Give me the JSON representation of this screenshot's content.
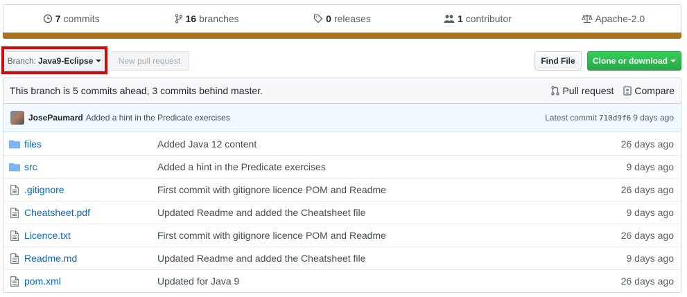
{
  "summary": {
    "commits": {
      "count": "7",
      "label": "commits"
    },
    "branches": {
      "count": "16",
      "label": "branches"
    },
    "releases": {
      "count": "0",
      "label": "releases"
    },
    "contributors": {
      "count": "1",
      "label": "contributor"
    },
    "license": "Apache-2.0"
  },
  "language_bar_color": "#b07219",
  "toolbar": {
    "branch_label": "Branch:",
    "branch_value": "Java9-Eclipse",
    "new_pr": "New pull request",
    "find_file": "Find File",
    "clone": "Clone or download"
  },
  "branch_info": {
    "text": "This branch is 5 commits ahead, 3 commits behind master.",
    "pull_request": "Pull request",
    "compare": "Compare"
  },
  "commit": {
    "author": "JosePaumard",
    "message": "Added a hint in the Predicate exercises",
    "latest_label": "Latest commit",
    "sha": "710d9f6",
    "age": "9 days ago"
  },
  "files": [
    {
      "type": "folder",
      "name": "files",
      "message": "Added Java 12 content",
      "age": "26 days ago"
    },
    {
      "type": "folder",
      "name": "src",
      "message": "Added a hint in the Predicate exercises",
      "age": "9 days ago"
    },
    {
      "type": "file",
      "name": ".gitignore",
      "message": "First commit with gitignore licence POM and Readme",
      "age": "26 days ago"
    },
    {
      "type": "file",
      "name": "Cheatsheet.pdf",
      "message": "Updated Readme and added the Cheatsheet file",
      "age": "9 days ago"
    },
    {
      "type": "file",
      "name": "Licence.txt",
      "message": "First commit with gitignore licence POM and Readme",
      "age": "26 days ago"
    },
    {
      "type": "file",
      "name": "Readme.md",
      "message": "Updated Readme and added the Cheatsheet file",
      "age": "9 days ago"
    },
    {
      "type": "file",
      "name": "pom.xml",
      "message": "Updated for Java 9",
      "age": "26 days ago"
    }
  ]
}
